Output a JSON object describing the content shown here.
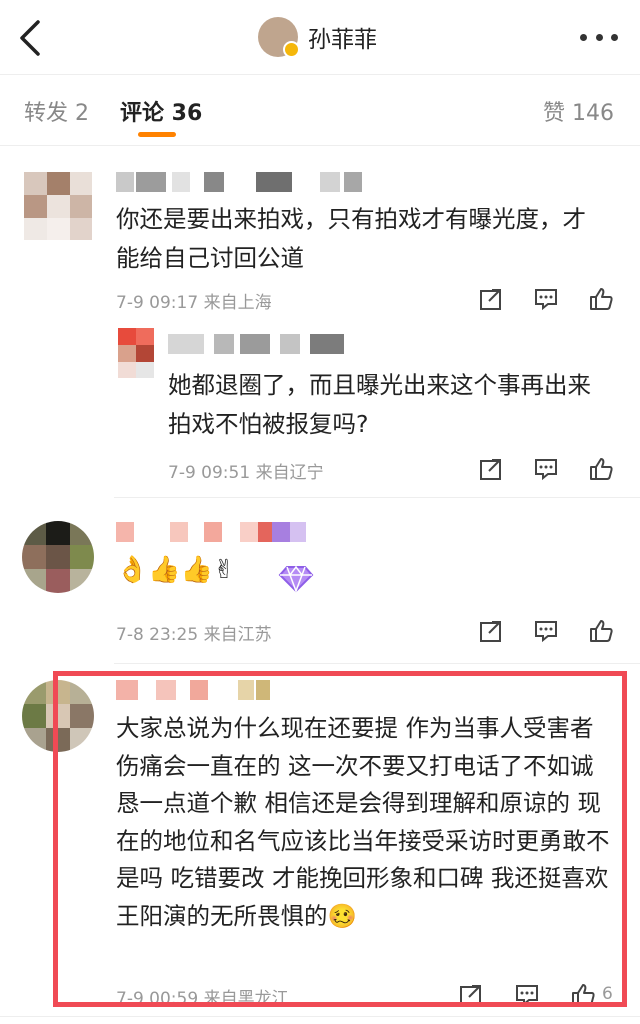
{
  "header": {
    "username": "孙菲菲",
    "back_icon": "back-chevron-icon",
    "more_icon": "more-dots-icon"
  },
  "tabs": [
    {
      "label": "转发 2"
    },
    {
      "label": "评论 36"
    },
    {
      "label": "赞 146"
    }
  ],
  "comments": [
    {
      "text": "你还是要出来拍戏，只有拍戏才有曝光度，才能给自己讨回公道",
      "meta": "7-9 09:17  来自上海",
      "reply": {
        "text": "她都退圈了，而且曝光出来这个事再出来拍戏不怕被报复吗?",
        "meta": "7-9 09:51  来自辽宁"
      }
    },
    {
      "text": "👌👍👍✌",
      "meta": "7-8 23:25  来自江苏"
    },
    {
      "text": "大家总说为什么现在还要提 作为当事人受害者 伤痛会一直在的 这一次不要又打电话了不如诚恳一点道个歉 相信还是会得到理解和原谅的 现在的地位和名气应该比当年接受采访时更勇敢不是吗 吃错要改 才能挽回形象和口碑 我还挺喜欢王阳演的无所畏惧的🥴",
      "meta": "7-9 00:59  来自黑龙江",
      "likes": "6"
    }
  ],
  "colors": {
    "accent": "#ff8200",
    "highlight_border": "#f04a55",
    "meta_gray": "#999999"
  }
}
